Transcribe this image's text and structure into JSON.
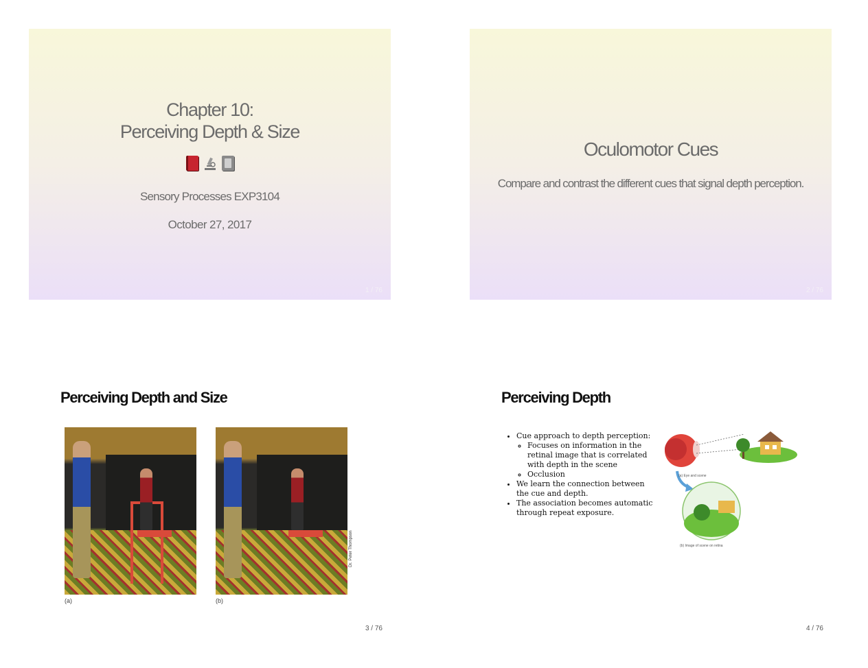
{
  "slides": [
    {
      "title_line1": "Chapter 10:",
      "title_line2": "Perceiving Depth & Size",
      "icons": [
        "book-red-icon",
        "microscope-icon",
        "book-gray-icon"
      ],
      "course": "Sensory Processes EXP3104",
      "date": "October 27, 2017",
      "page": "1 / 76"
    },
    {
      "title": "Oculomotor Cues",
      "subtitle": "Compare and contrast the different cues that signal depth perception.",
      "page": "2 / 76"
    },
    {
      "title": "Perceiving Depth and Size",
      "caption_a": "(a)",
      "caption_b": "(b)",
      "credit": "Dr. Peter Thompson",
      "page": "3 / 76"
    },
    {
      "title": "Perceiving Depth",
      "bullets": [
        "Cue approach to depth perception:",
        "Focuses on information in the retinal image that is correlated with depth in the scene",
        "Occlusion",
        "We learn the connection between the cue and depth.",
        "The association becomes automatic through repeat exposure."
      ],
      "fig_caption_a": "(a) Eye and scene",
      "fig_caption_b": "(b) Image of scene on retina",
      "page": "4 / 76"
    }
  ],
  "colors": {
    "title_text": "#6b6b6b",
    "gradient_top": "#f8f7da",
    "gradient_bottom": "#ebdff8"
  }
}
